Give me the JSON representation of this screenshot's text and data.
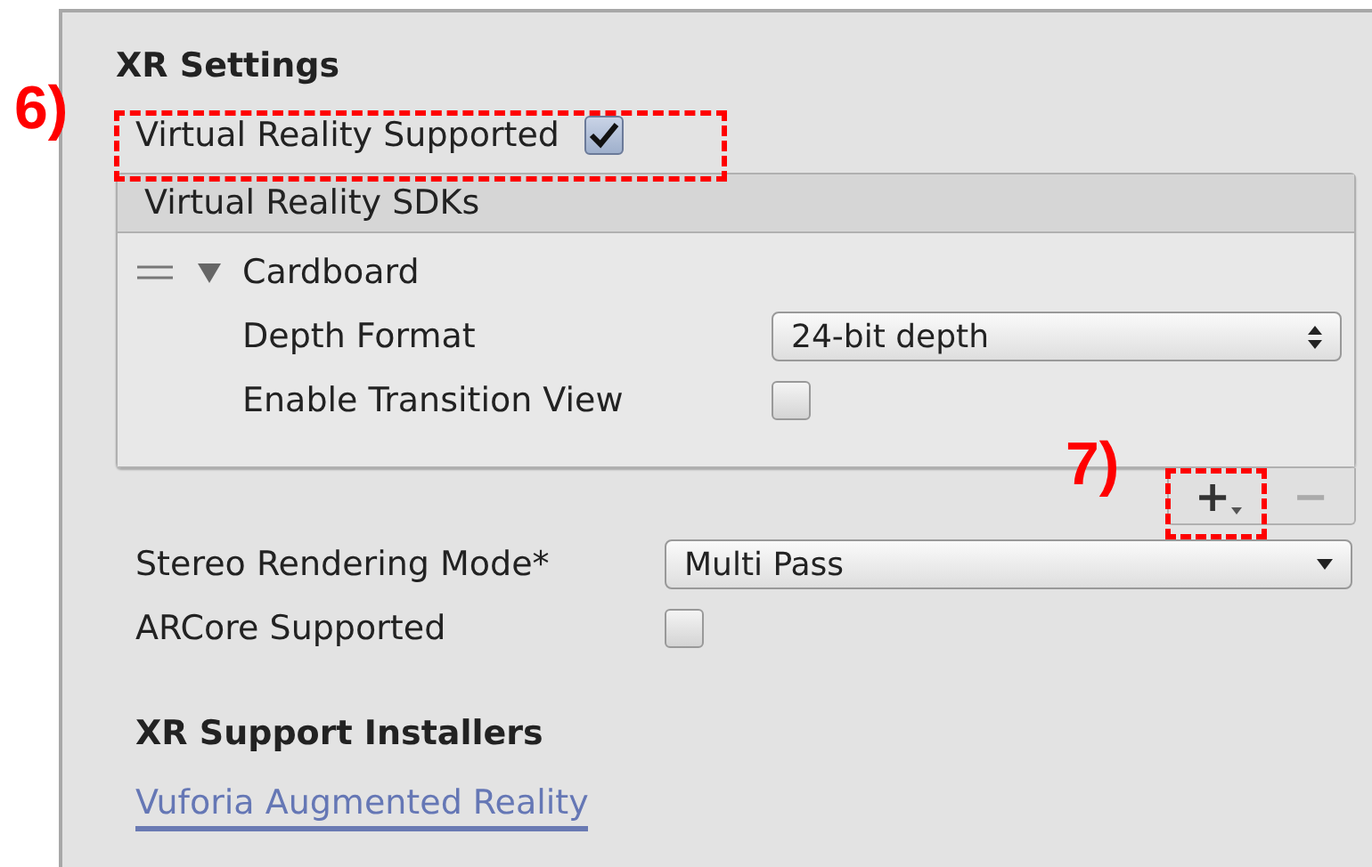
{
  "section_title": "XR Settings",
  "vr_supported": {
    "label": "Virtual Reality Supported",
    "checked": true
  },
  "sdk_list": {
    "header": "Virtual Reality SDKs",
    "items": [
      {
        "name": "Cardboard",
        "expanded": true,
        "fields": [
          {
            "kind": "popup",
            "label": "Depth Format",
            "value": "24-bit depth"
          },
          {
            "kind": "checkbox",
            "label": "Enable Transition View",
            "checked": false
          }
        ]
      }
    ],
    "buttons": [
      {
        "label": "+",
        "disabled": false,
        "menu": true
      },
      {
        "label": "−",
        "disabled": true,
        "menu": false
      }
    ]
  },
  "settings": [
    {
      "kind": "dropdown",
      "label": "Stereo Rendering Mode*",
      "value": "Multi Pass"
    },
    {
      "kind": "checkbox",
      "label": "ARCore Supported",
      "checked": false
    }
  ],
  "installers": {
    "title": "XR Support Installers",
    "links": [
      "Vuforia Augmented Reality"
    ]
  },
  "annotations": [
    {
      "label": "6)"
    },
    {
      "label": "7)"
    }
  ]
}
